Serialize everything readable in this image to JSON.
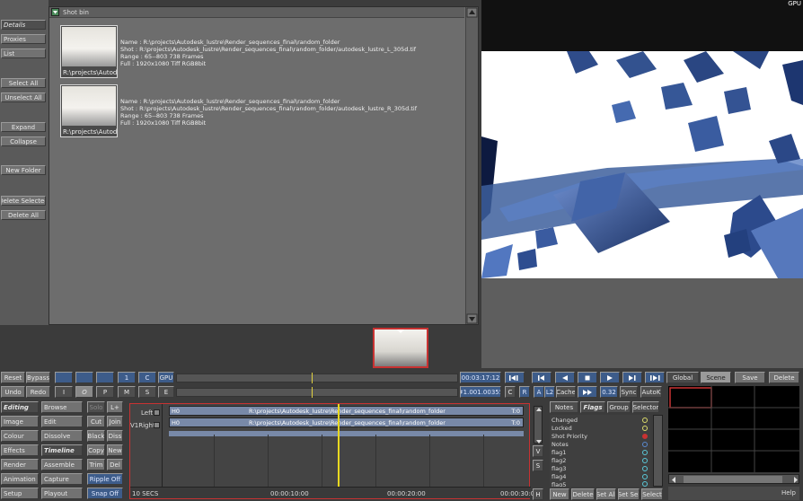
{
  "viewer": {
    "corner_label": "GPU"
  },
  "left_panel": {
    "buttons": [
      "Details",
      "Proxies",
      "List",
      "Select All",
      "Unselect All",
      "Expand",
      "Collapse",
      "New Folder",
      "Delete Selected",
      "Delete All"
    ]
  },
  "shot_bin": {
    "title": "Shot bin",
    "items": [
      {
        "caption": "R:\\projects\\Autodesk",
        "name": "Name : R:\\projects\\Autodesk_lustre\\Render_sequences_final\\random_folder",
        "shot": "Shot : R:\\projects\\Autodesk_lustre\\Render_sequences_final\\random_folder/autodesk_lustre_L_305d.tif",
        "range": "Range : 65--803 738 Frames",
        "full": "Full : 1920x1080  Tiff RGB8bit"
      },
      {
        "caption": "R:\\projects\\Autodesk",
        "name": "Name : R:\\projects\\Autodesk_lustre\\Render_sequences_final\\random_folder",
        "shot": "Shot : R:\\projects\\Autodesk_lustre\\Render_sequences_final\\random_folder/autodesk_lustre_R_305d.tif",
        "range": "Range : 65--803 738 Frames",
        "full": "Full : 1920x1080  Tiff RGB8bit"
      }
    ]
  },
  "transport": {
    "reset": "Reset",
    "bypass": "Bypass",
    "undo": "Undo",
    "redo": "Redo",
    "btn_1": "1",
    "btn_c": "C",
    "btn_i": "I",
    "btn_o": "O",
    "btn_p": "P",
    "btn_m": "M",
    "btn_s": "S",
    "btn_e": "E",
    "gpu": "GPU",
    "timecode": "00:03:17:12",
    "frame": "#1.001.00355",
    "c_label": "C",
    "r_label": "R",
    "a_label": "A",
    "l2_label": "L2",
    "cache": "Cache",
    "speed": "0.32",
    "sync": "Sync",
    "autok": "AutoK",
    "global": "Global",
    "scene": "Scene",
    "save": "Save",
    "delete": "Delete"
  },
  "menus": {
    "col1": [
      "Editing",
      "Image",
      "Colour",
      "Effects",
      "Render",
      "Animation",
      "Setup"
    ],
    "col2": [
      "Browse",
      "Edit",
      "Dissolve",
      "Timeline",
      "Assemble",
      "Capture",
      "Playout"
    ],
    "col3": [
      "Solo",
      "Cut",
      "Black",
      "Copy",
      "Trim",
      "Ripple Off",
      "Snap Off"
    ],
    "col4": [
      "L+",
      "Join",
      "Diss",
      "New",
      "Del"
    ]
  },
  "timeline": {
    "left_label": "Left",
    "right_label": "V1Right",
    "tracks": [
      {
        "id": "H0",
        "path": "R:\\projects\\Autodesk_lustre\\Render_sequences_final\\random_folder",
        "tag": "T:0"
      },
      {
        "id": "H0",
        "path": "R:\\projects\\Autodesk_lustre\\Render_sequences_final\\random_folder",
        "tag": "T:0"
      }
    ],
    "scale": "10 SECS",
    "marks": [
      "00:00:10:00",
      "00:00:20:00",
      "00:00:30:0"
    ],
    "vs": [
      "V",
      "S",
      "H"
    ]
  },
  "flags_panel": {
    "tabs": [
      "Notes",
      "Flags",
      "Group",
      "Selector"
    ],
    "items": [
      "Changed",
      "Locked",
      "Shot Priority",
      "Notes",
      "flag1",
      "flag2",
      "flag3",
      "flag4",
      "flag5"
    ],
    "dot_colors": [
      "#dcdc6a",
      "#dcdc6a",
      "#c83232",
      "#5a8ad0",
      "#5ac8d8",
      "#5ac8d8",
      "#5ac8d8",
      "#5ac8d8",
      "#5ac8d8"
    ],
    "buttons": [
      "New",
      "Delete",
      "Set All",
      "Set Sel",
      "Select"
    ]
  },
  "grid_panel": {
    "help": "Help"
  }
}
